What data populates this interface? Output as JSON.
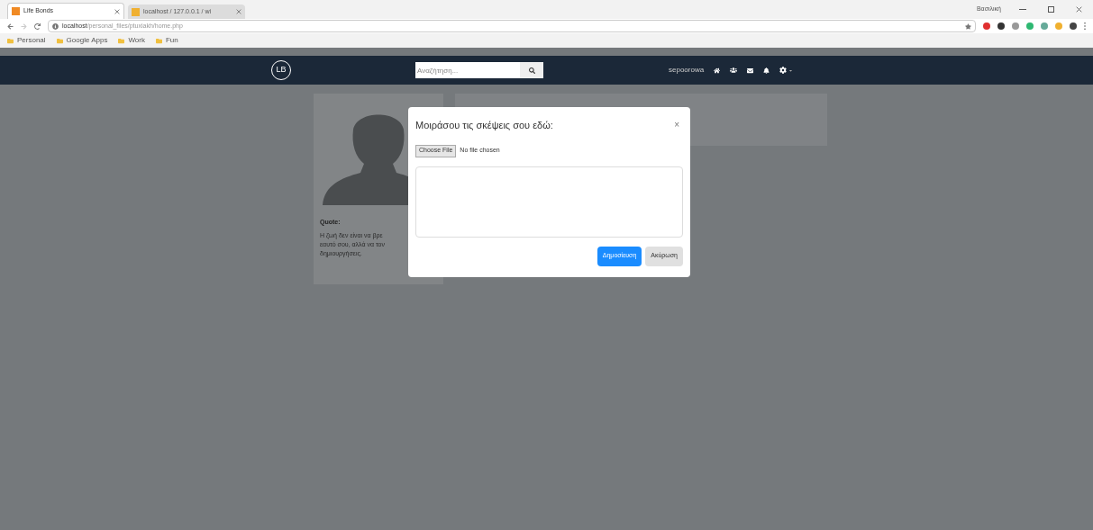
{
  "browser": {
    "tabs": [
      {
        "title": "Life Bonds",
        "selected": true
      },
      {
        "title": "localhost / 127.0.0.1 / wi",
        "selected": false
      }
    ],
    "profile": "Βασιλική",
    "url_host": "localhost",
    "url_path": "/personal_files/ptuxiakh/home.php",
    "bookmarks": [
      "Personal",
      "Google Apps",
      "Work",
      "Fun"
    ]
  },
  "navbar": {
    "logo": "LB",
    "search": {
      "placeholder": "Αναζήτηση..."
    },
    "username": "sepoorowa"
  },
  "profile_card": {
    "quote_label": "Quote:",
    "quote_lines": [
      "Η ζωή δεν είναι να βρε",
      "εαυτό σου, αλλά να τον",
      "δημιουργήσεις."
    ]
  },
  "modal": {
    "title": "Μοιράσου τις σκέψεις σου εδώ:",
    "close": "×",
    "file_button": "Choose File",
    "file_status": "No file chosen",
    "buttons": [
      {
        "label": "Δημοσίευση",
        "kind": "primary"
      },
      {
        "label": "Ακύρωση",
        "kind": "secondary"
      }
    ]
  }
}
